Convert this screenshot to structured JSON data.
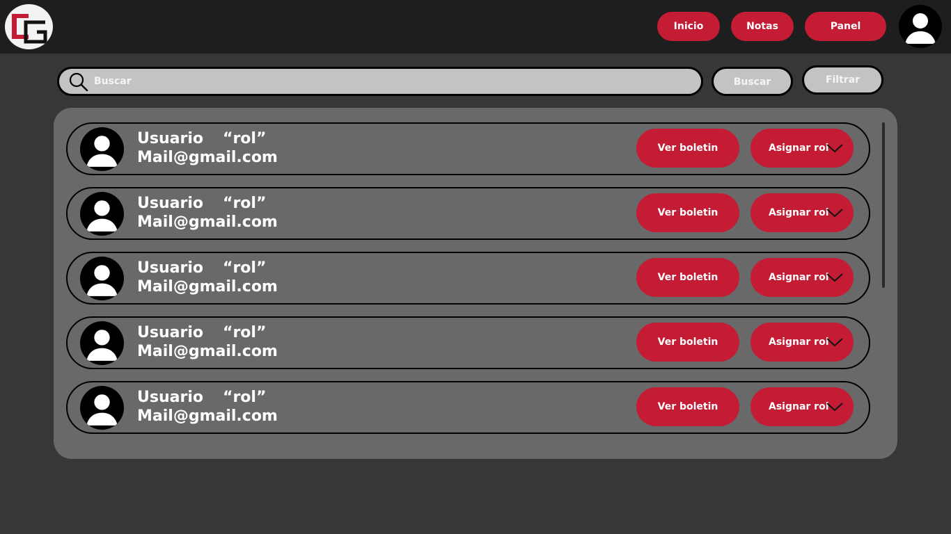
{
  "header": {
    "logo_text": "CG",
    "nav": [
      {
        "label": "Inicio"
      },
      {
        "label": "Notas"
      },
      {
        "label": "Panel"
      }
    ]
  },
  "search": {
    "placeholder": "Buscar",
    "value": "",
    "button_label": "Buscar",
    "filter_label": "Filtrar"
  },
  "users": [
    {
      "name": "Usuario",
      "role": "“rol”",
      "email": "Mail@gmail.com",
      "view_label": "Ver boletin",
      "assign_label": "Asignar rol"
    },
    {
      "name": "Usuario",
      "role": "“rol”",
      "email": "Mail@gmail.com",
      "view_label": "Ver boletin",
      "assign_label": "Asignar rol"
    },
    {
      "name": "Usuario",
      "role": "“rol”",
      "email": "Mail@gmail.com",
      "view_label": "Ver boletin",
      "assign_label": "Asignar rol"
    },
    {
      "name": "Usuario",
      "role": "“rol”",
      "email": "Mail@gmail.com",
      "view_label": "Ver boletin",
      "assign_label": "Asignar rol"
    },
    {
      "name": "Usuario",
      "role": "“rol”",
      "email": "Mail@gmail.com",
      "view_label": "Ver boletin",
      "assign_label": "Asignar rol"
    }
  ],
  "icons": {
    "logo": "cg-logo-icon",
    "profile": "user-avatar-icon",
    "search": "search-icon",
    "dropdown": "chevron-down-icon"
  },
  "colors": {
    "accent": "#c51c35",
    "topbar": "#1e1e1e",
    "background": "#373737",
    "panel": "#696969",
    "search_fill": "#c3c3c3"
  }
}
